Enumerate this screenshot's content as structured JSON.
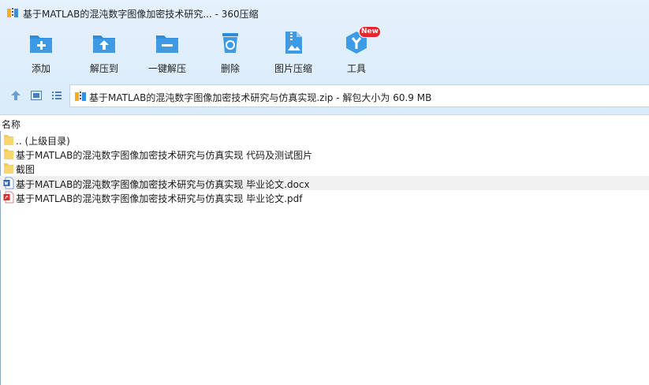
{
  "window": {
    "title": "基于MATLAB的混沌数字图像加密技术研究... - 360压缩"
  },
  "toolbar": {
    "add": "添加",
    "extract_to": "解压到",
    "one_click_extract": "一键解压",
    "delete": "删除",
    "image_compress": "图片压缩",
    "tools": "工具",
    "tools_badge": "New"
  },
  "addressbar": {
    "path": "基于MATLAB的混沌数字图像加密技术研究与仿真实现.zip - 解包大小为 60.9 MB"
  },
  "filelist": {
    "column_name": "名称",
    "rows": [
      {
        "name": ".. (上级目录)",
        "icon": "folder-icon"
      },
      {
        "name": "基于MATLAB的混沌数字图像加密技术研究与仿真实现 代码及测试图片",
        "icon": "folder-icon"
      },
      {
        "name": "截图",
        "icon": "folder-icon"
      },
      {
        "name": "基于MATLAB的混沌数字图像加密技术研究与仿真实现 毕业论文.docx",
        "icon": "word-doc-icon"
      },
      {
        "name": "基于MATLAB的混沌数字图像加密技术研究与仿真实现 毕业论文.pdf",
        "icon": "pdf-icon"
      }
    ]
  },
  "colors": {
    "toolbar_bg": "#dcedfb",
    "icon_blue": "#2e8bd8",
    "badge_red": "#e8262d"
  }
}
